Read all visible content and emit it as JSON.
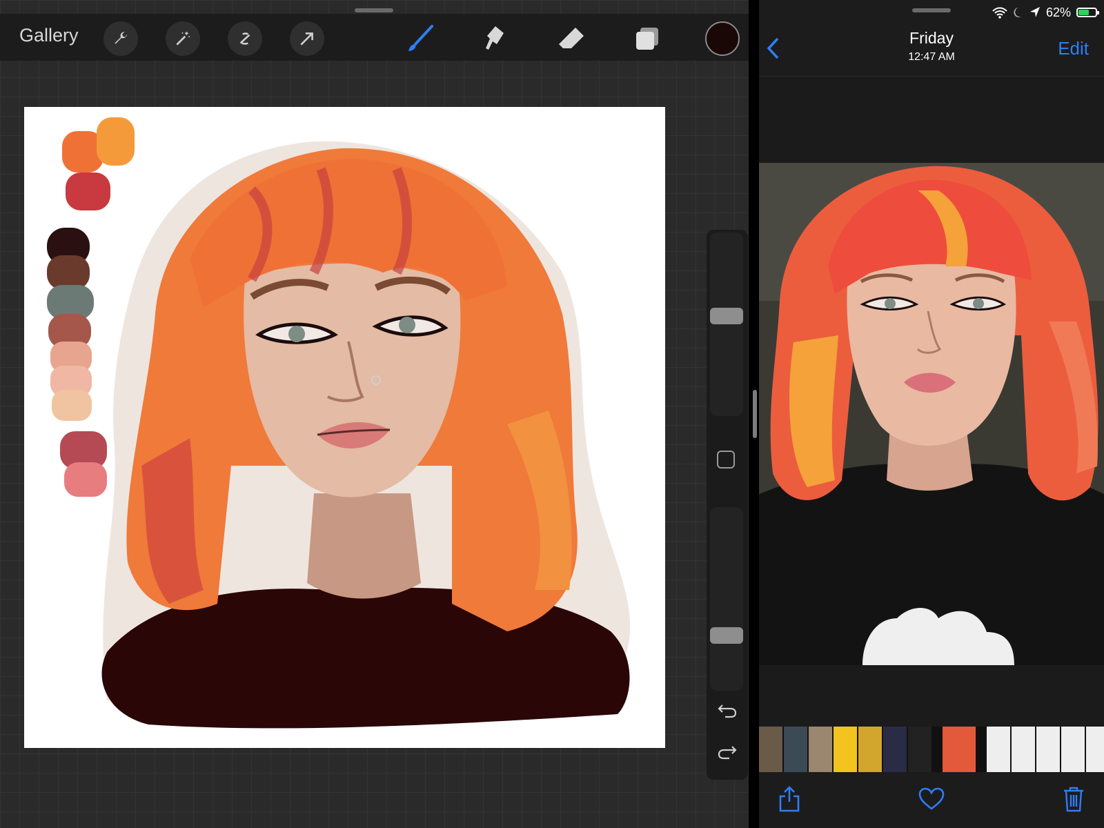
{
  "left_app": {
    "gallery_label": "Gallery",
    "tools": [
      {
        "name": "wrench-icon"
      },
      {
        "name": "magic-wand-icon"
      },
      {
        "name": "selection-icon"
      },
      {
        "name": "transform-arrow-icon"
      },
      {
        "name": "brush-icon",
        "active": true
      },
      {
        "name": "smudge-icon"
      },
      {
        "name": "eraser-icon"
      },
      {
        "name": "layers-icon"
      }
    ],
    "current_color": "#1a0807",
    "sidebar": {
      "brush_size_level": 0.55,
      "opacity_level": 0.28
    },
    "palette": [
      "#f07135",
      "#f59a3b",
      "#c83a3f",
      "#2a1010",
      "#6a3a2c",
      "#6b7a74",
      "#a4574a",
      "#e7a48e",
      "#f0b7a4",
      "#f0c4a1",
      "#b54a55",
      "#e77d7f"
    ]
  },
  "right_app": {
    "status": {
      "battery_text": "62%",
      "battery_level": 0.62
    },
    "nav": {
      "title": "Friday",
      "subtitle": "12:47 AM",
      "edit_label": "Edit"
    },
    "thumbnails": [
      "#6a5a48",
      "#3c4a55",
      "#9b8770",
      "#f3c420",
      "#d2a62d",
      "#2a2c45",
      "#222",
      "#e35a3b",
      "#eeeeee",
      "#eeeeee",
      "#eeeeee",
      "#eeeeee",
      "#eeeeee",
      "#eeeeee"
    ],
    "colors": {
      "accent": "#2f7df6",
      "battery": "#31d158"
    }
  }
}
